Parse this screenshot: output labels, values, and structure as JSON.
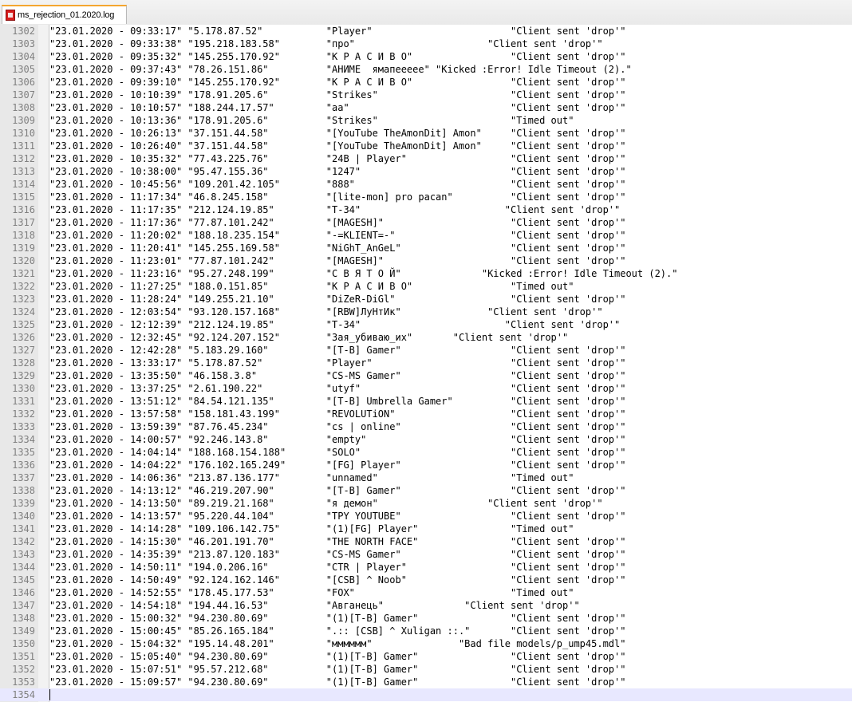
{
  "tab": {
    "title": "ms_rejection_01.2020.log",
    "icon": "log-file-icon"
  },
  "editor": {
    "lines": [
      {
        "n": "1302",
        "t": "\"23.01.2020 - 09:33:17\" \"5.178.87.52\"           \"Player\"                        \"Client sent 'drop'\""
      },
      {
        "n": "1303",
        "t": "\"23.01.2020 - 09:33:38\" \"195.218.183.58\"        \"про\"                       \"Client sent 'drop'\""
      },
      {
        "n": "1304",
        "t": "\"23.01.2020 - 09:35:32\" \"145.255.170.92\"        \"К Р А С И В О\"                 \"Client sent 'drop'\""
      },
      {
        "n": "1305",
        "t": "\"23.01.2020 - 09:37:43\" \"78.26.151.86\"          \"АНИМЕ  ямапеееее\" \"Kicked :Error! Idle Timeout (2).\""
      },
      {
        "n": "1306",
        "t": "\"23.01.2020 - 09:39:10\" \"145.255.170.92\"        \"К Р А С И В О\"                 \"Client sent 'drop'\""
      },
      {
        "n": "1307",
        "t": "\"23.01.2020 - 10:10:39\" \"178.91.205.6\"          \"Strikes\"                       \"Client sent 'drop'\""
      },
      {
        "n": "1308",
        "t": "\"23.01.2020 - 10:10:57\" \"188.244.17.57\"         \"aa\"                            \"Client sent 'drop'\""
      },
      {
        "n": "1309",
        "t": "\"23.01.2020 - 10:13:36\" \"178.91.205.6\"          \"Strikes\"                       \"Timed out\""
      },
      {
        "n": "1310",
        "t": "\"23.01.2020 - 10:26:13\" \"37.151.44.58\"          \"[YouTube TheAmonDit] Amon\"     \"Client sent 'drop'\""
      },
      {
        "n": "1311",
        "t": "\"23.01.2020 - 10:26:40\" \"37.151.44.58\"          \"[YouTube TheAmonDit] Amon\"     \"Client sent 'drop'\""
      },
      {
        "n": "1312",
        "t": "\"23.01.2020 - 10:35:32\" \"77.43.225.76\"          \"24B | Player\"                  \"Client sent 'drop'\""
      },
      {
        "n": "1313",
        "t": "\"23.01.2020 - 10:38:00\" \"95.47.155.36\"          \"1247\"                          \"Client sent 'drop'\""
      },
      {
        "n": "1314",
        "t": "\"23.01.2020 - 10:45:56\" \"109.201.42.105\"        \"888\"                           \"Client sent 'drop'\""
      },
      {
        "n": "1315",
        "t": "\"23.01.2020 - 11:17:34\" \"46.8.245.158\"          \"[lite-mon] pro pacan\"          \"Client sent 'drop'\""
      },
      {
        "n": "1316",
        "t": "\"23.01.2020 - 11:17:35\" \"212.124.19.85\"         \"T-34\"                         \"Client sent 'drop'\""
      },
      {
        "n": "1317",
        "t": "\"23.01.2020 - 11:17:36\" \"77.87.101.242\"         \"[MAGESH]\"                      \"Client sent 'drop'\""
      },
      {
        "n": "1318",
        "t": "\"23.01.2020 - 11:20:02\" \"188.18.235.154\"        \"-=KLIENT=-\"                    \"Client sent 'drop'\""
      },
      {
        "n": "1319",
        "t": "\"23.01.2020 - 11:20:41\" \"145.255.169.58\"        \"NiGhT_AnGeL\"                   \"Client sent 'drop'\""
      },
      {
        "n": "1320",
        "t": "\"23.01.2020 - 11:23:01\" \"77.87.101.242\"         \"[MAGESH]\"                      \"Client sent 'drop'\""
      },
      {
        "n": "1321",
        "t": "\"23.01.2020 - 11:23:16\" \"95.27.248.199\"         \"С В Я Т О Й\"              \"Kicked :Error! Idle Timeout (2).\""
      },
      {
        "n": "1322",
        "t": "\"23.01.2020 - 11:27:25\" \"188.0.151.85\"          \"К Р А С И В О\"                 \"Timed out\""
      },
      {
        "n": "1323",
        "t": "\"23.01.2020 - 11:28:24\" \"149.255.21.10\"         \"DiZeR-DiGl\"                    \"Client sent 'drop'\""
      },
      {
        "n": "1324",
        "t": "\"23.01.2020 - 12:03:54\" \"93.120.157.168\"        \"[RBW]ЛуНтИк\"               \"Client sent 'drop'\""
      },
      {
        "n": "1325",
        "t": "\"23.01.2020 - 12:12:39\" \"212.124.19.85\"         \"T-34\"                         \"Client sent 'drop'\""
      },
      {
        "n": "1326",
        "t": "\"23.01.2020 - 12:32:45\" \"92.124.207.152\"        \"Зая_убиваю_их\"       \"Client sent 'drop'\""
      },
      {
        "n": "1327",
        "t": "\"23.01.2020 - 12:42:28\" \"5.183.29.160\"          \"[T-B] Gamer\"                   \"Client sent 'drop'\""
      },
      {
        "n": "1328",
        "t": "\"23.01.2020 - 13:33:17\" \"5.178.87.52\"           \"Player\"                        \"Client sent 'drop'\""
      },
      {
        "n": "1329",
        "t": "\"23.01.2020 - 13:35:50\" \"46.158.3.8\"            \"CS-MS Gamer\"                   \"Client sent 'drop'\""
      },
      {
        "n": "1330",
        "t": "\"23.01.2020 - 13:37:25\" \"2.61.190.22\"           \"utyf\"                          \"Client sent 'drop'\""
      },
      {
        "n": "1331",
        "t": "\"23.01.2020 - 13:51:12\" \"84.54.121.135\"         \"[T-B] Umbrella Gamer\"          \"Client sent 'drop'\""
      },
      {
        "n": "1332",
        "t": "\"23.01.2020 - 13:57:58\" \"158.181.43.199\"        \"REVOLUTiON\"                    \"Client sent 'drop'\""
      },
      {
        "n": "1333",
        "t": "\"23.01.2020 - 13:59:39\" \"87.76.45.234\"          \"cs | online\"                   \"Client sent 'drop'\""
      },
      {
        "n": "1334",
        "t": "\"23.01.2020 - 14:00:57\" \"92.246.143.8\"          \"empty\"                         \"Client sent 'drop'\""
      },
      {
        "n": "1335",
        "t": "\"23.01.2020 - 14:04:14\" \"188.168.154.188\"       \"SOLO\"                          \"Client sent 'drop'\""
      },
      {
        "n": "1336",
        "t": "\"23.01.2020 - 14:04:22\" \"176.102.165.249\"       \"[FG] Player\"                   \"Client sent 'drop'\""
      },
      {
        "n": "1337",
        "t": "\"23.01.2020 - 14:06:36\" \"213.87.136.177\"        \"unnamed\"                       \"Timed out\""
      },
      {
        "n": "1338",
        "t": "\"23.01.2020 - 14:13:12\" \"46.219.207.90\"         \"[T-B] Gamer\"                   \"Client sent 'drop'\""
      },
      {
        "n": "1339",
        "t": "\"23.01.2020 - 14:13:50\" \"89.219.21.168\"         \"я демон\"                   \"Client sent 'drop'\""
      },
      {
        "n": "1340",
        "t": "\"23.01.2020 - 14:13:57\" \"95.220.44.104\"         \"TPY YOUTUBE\"                   \"Client sent 'drop'\""
      },
      {
        "n": "1341",
        "t": "\"23.01.2020 - 14:14:28\" \"109.106.142.75\"        \"(1)[FG] Player\"                \"Timed out\""
      },
      {
        "n": "1342",
        "t": "\"23.01.2020 - 14:15:30\" \"46.201.191.70\"         \"THE NORTH FACE\"                \"Client sent 'drop'\""
      },
      {
        "n": "1343",
        "t": "\"23.01.2020 - 14:35:39\" \"213.87.120.183\"        \"CS-MS Gamer\"                   \"Client sent 'drop'\""
      },
      {
        "n": "1344",
        "t": "\"23.01.2020 - 14:50:11\" \"194.0.206.16\"          \"CTR | Player\"                  \"Client sent 'drop'\""
      },
      {
        "n": "1345",
        "t": "\"23.01.2020 - 14:50:49\" \"92.124.162.146\"        \"[CSB] ^ Noob\"                  \"Client sent 'drop'\""
      },
      {
        "n": "1346",
        "t": "\"23.01.2020 - 14:52:55\" \"178.45.177.53\"         \"FOX\"                           \"Timed out\""
      },
      {
        "n": "1347",
        "t": "\"23.01.2020 - 14:54:18\" \"194.44.16.53\"          \"Авганець\"              \"Client sent 'drop'\""
      },
      {
        "n": "1348",
        "t": "\"23.01.2020 - 15:00:32\" \"94.230.80.69\"          \"(1)[T-B] Gamer\"                \"Client sent 'drop'\""
      },
      {
        "n": "1349",
        "t": "\"23.01.2020 - 15:00:45\" \"85.26.165.184\"         \".:: [CSB] ^ Xuligan ::.\"       \"Client sent 'drop'\""
      },
      {
        "n": "1350",
        "t": "\"23.01.2020 - 15:04:32\" \"195.14.48.201\"         \"мммммм\"               \"Bad file models/p_ump45.mdl\""
      },
      {
        "n": "1351",
        "t": "\"23.01.2020 - 15:05:40\" \"94.230.80.69\"          \"(1)[T-B] Gamer\"                \"Client sent 'drop'\""
      },
      {
        "n": "1352",
        "t": "\"23.01.2020 - 15:07:51\" \"95.57.212.68\"          \"(1)[T-B] Gamer\"                \"Client sent 'drop'\""
      },
      {
        "n": "1353",
        "t": "\"23.01.2020 - 15:09:57\" \"94.230.80.69\"          \"(1)[T-B] Gamer\"                \"Client sent 'drop'\""
      },
      {
        "n": "1354",
        "t": ""
      }
    ]
  }
}
